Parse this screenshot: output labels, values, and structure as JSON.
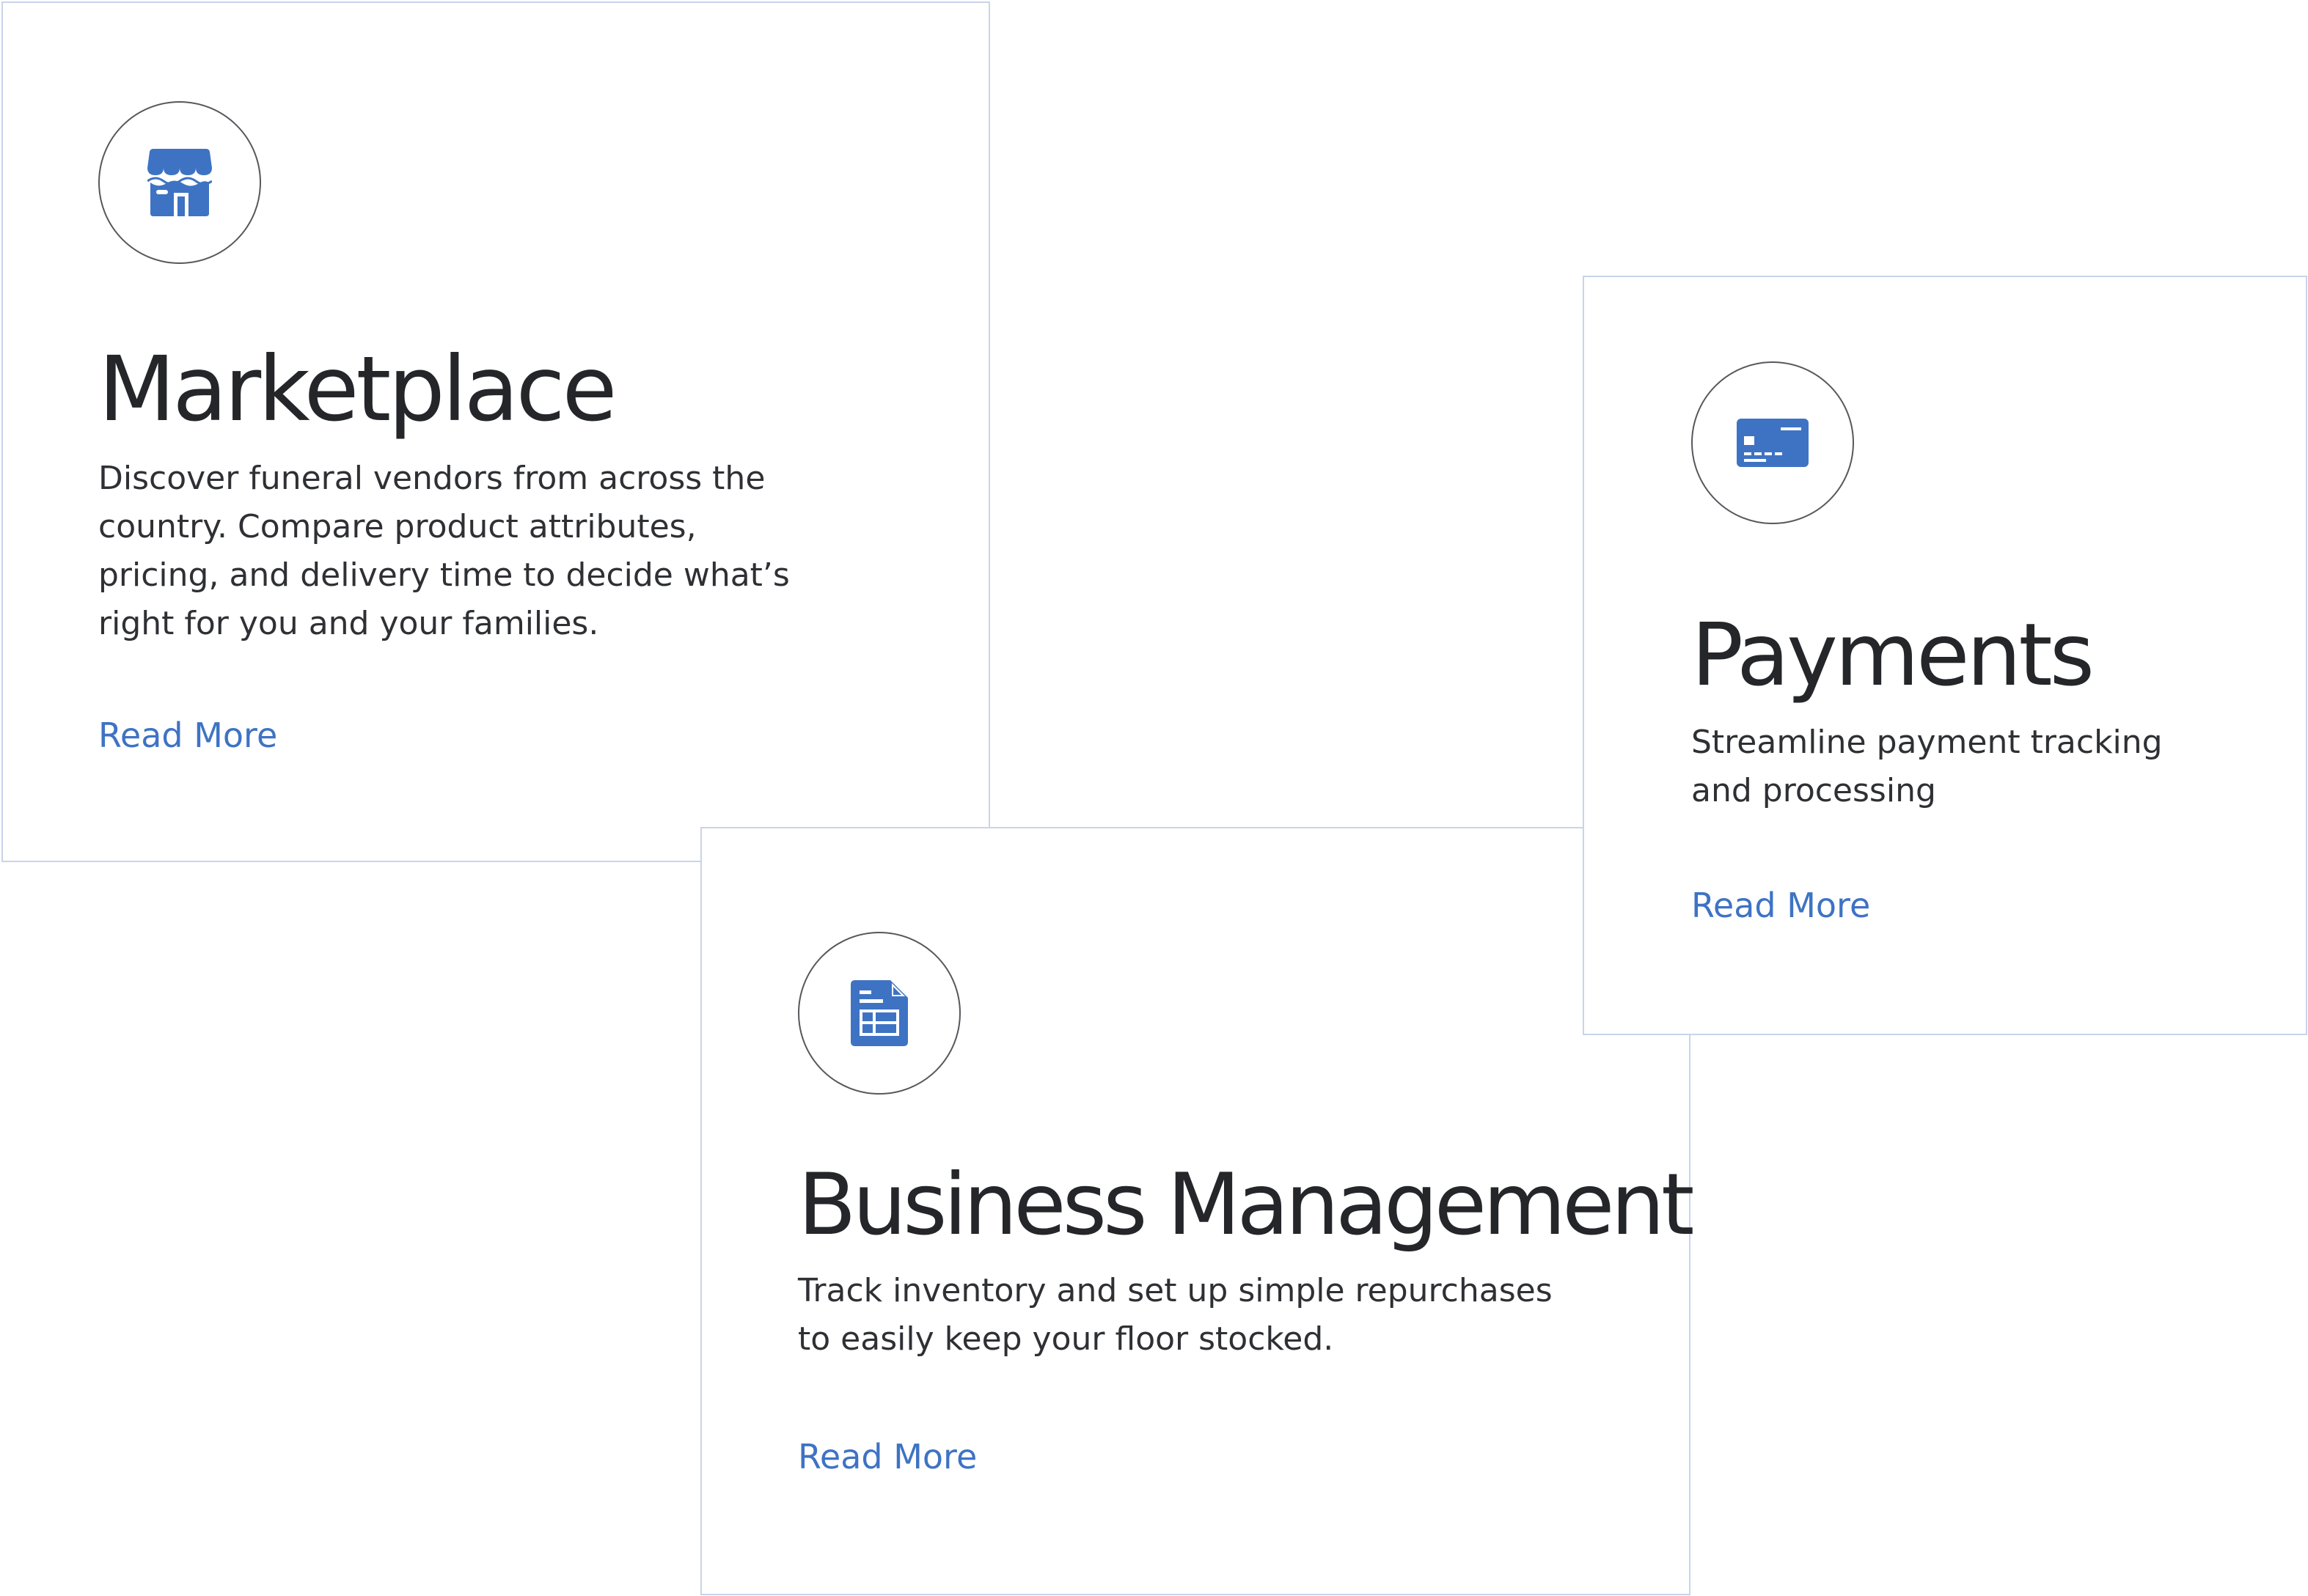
{
  "colors": {
    "accent": "#3e73c4",
    "card_border": "#c8d4ea",
    "text": "#25262a"
  },
  "cards": {
    "marketplace": {
      "icon": "storefront-icon",
      "title": "Marketplace",
      "description": "Discover funeral vendors from across the\ncountry. Compare product attributes,\npricing, and delivery time to decide what’s\nright for you and your families.",
      "link": "Read More"
    },
    "business_management": {
      "icon": "document-table-icon",
      "title": "Business Management",
      "description": "Track inventory and set up simple repurchases\nto easily keep your floor stocked.",
      "link": "Read More"
    },
    "payments": {
      "icon": "credit-card-icon",
      "title": "Payments",
      "description": "Streamline payment tracking\nand processing",
      "link": "Read More"
    }
  }
}
